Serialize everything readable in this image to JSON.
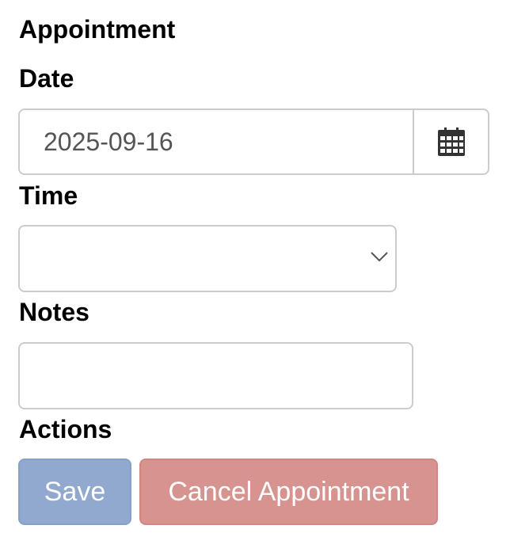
{
  "form": {
    "title": "Appointment",
    "date": {
      "label": "Date",
      "value": "2025-09-16",
      "picker_icon": "calendar-icon"
    },
    "time": {
      "label": "Time",
      "selected_value": "",
      "dropdown_icon": "chevron-down-icon"
    },
    "notes": {
      "label": "Notes",
      "value": ""
    },
    "actions": {
      "label": "Actions",
      "save_label": "Save",
      "cancel_label": "Cancel Appointment"
    }
  },
  "colors": {
    "save_button": "#92a9cf",
    "cancel_button": "#d6938f",
    "input_border": "#cccccc",
    "text": "#000000",
    "input_text": "#555555"
  }
}
